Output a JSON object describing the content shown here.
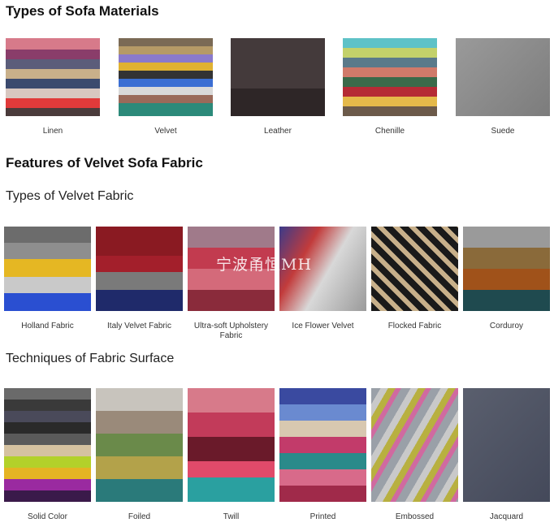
{
  "sections": {
    "materials_title": "Types of Sofa Materials",
    "velvet_features_title": "Features of Velvet Sofa Fabric",
    "velvet_types_title": "Types of Velvet Fabric",
    "techniques_title": "Techniques of Fabric Surface"
  },
  "materials": [
    {
      "label": "Linen",
      "icon": "linen-swatch-image"
    },
    {
      "label": "Velvet",
      "icon": "velvet-swatch-image"
    },
    {
      "label": "Leather",
      "icon": "leather-swatch-image"
    },
    {
      "label": "Chenille",
      "icon": "chenille-swatch-image"
    },
    {
      "label": "Suede",
      "icon": "suede-swatch-image"
    }
  ],
  "velvet_types": [
    {
      "label": "Holland Fabric"
    },
    {
      "label": "Italy Velvet Fabric"
    },
    {
      "label": "Ultra-soft Upholstery Fabric"
    },
    {
      "label": "Ice Flower Velvet"
    },
    {
      "label": "Flocked Fabric"
    },
    {
      "label": "Corduroy"
    }
  ],
  "techniques": [
    {
      "label": "Solid Color"
    },
    {
      "label": "Foiled"
    },
    {
      "label": "Twill"
    },
    {
      "label": "Printed"
    },
    {
      "label": "Embossed"
    },
    {
      "label": "Jacquard"
    }
  ],
  "watermark": "宁波甬恒MH"
}
